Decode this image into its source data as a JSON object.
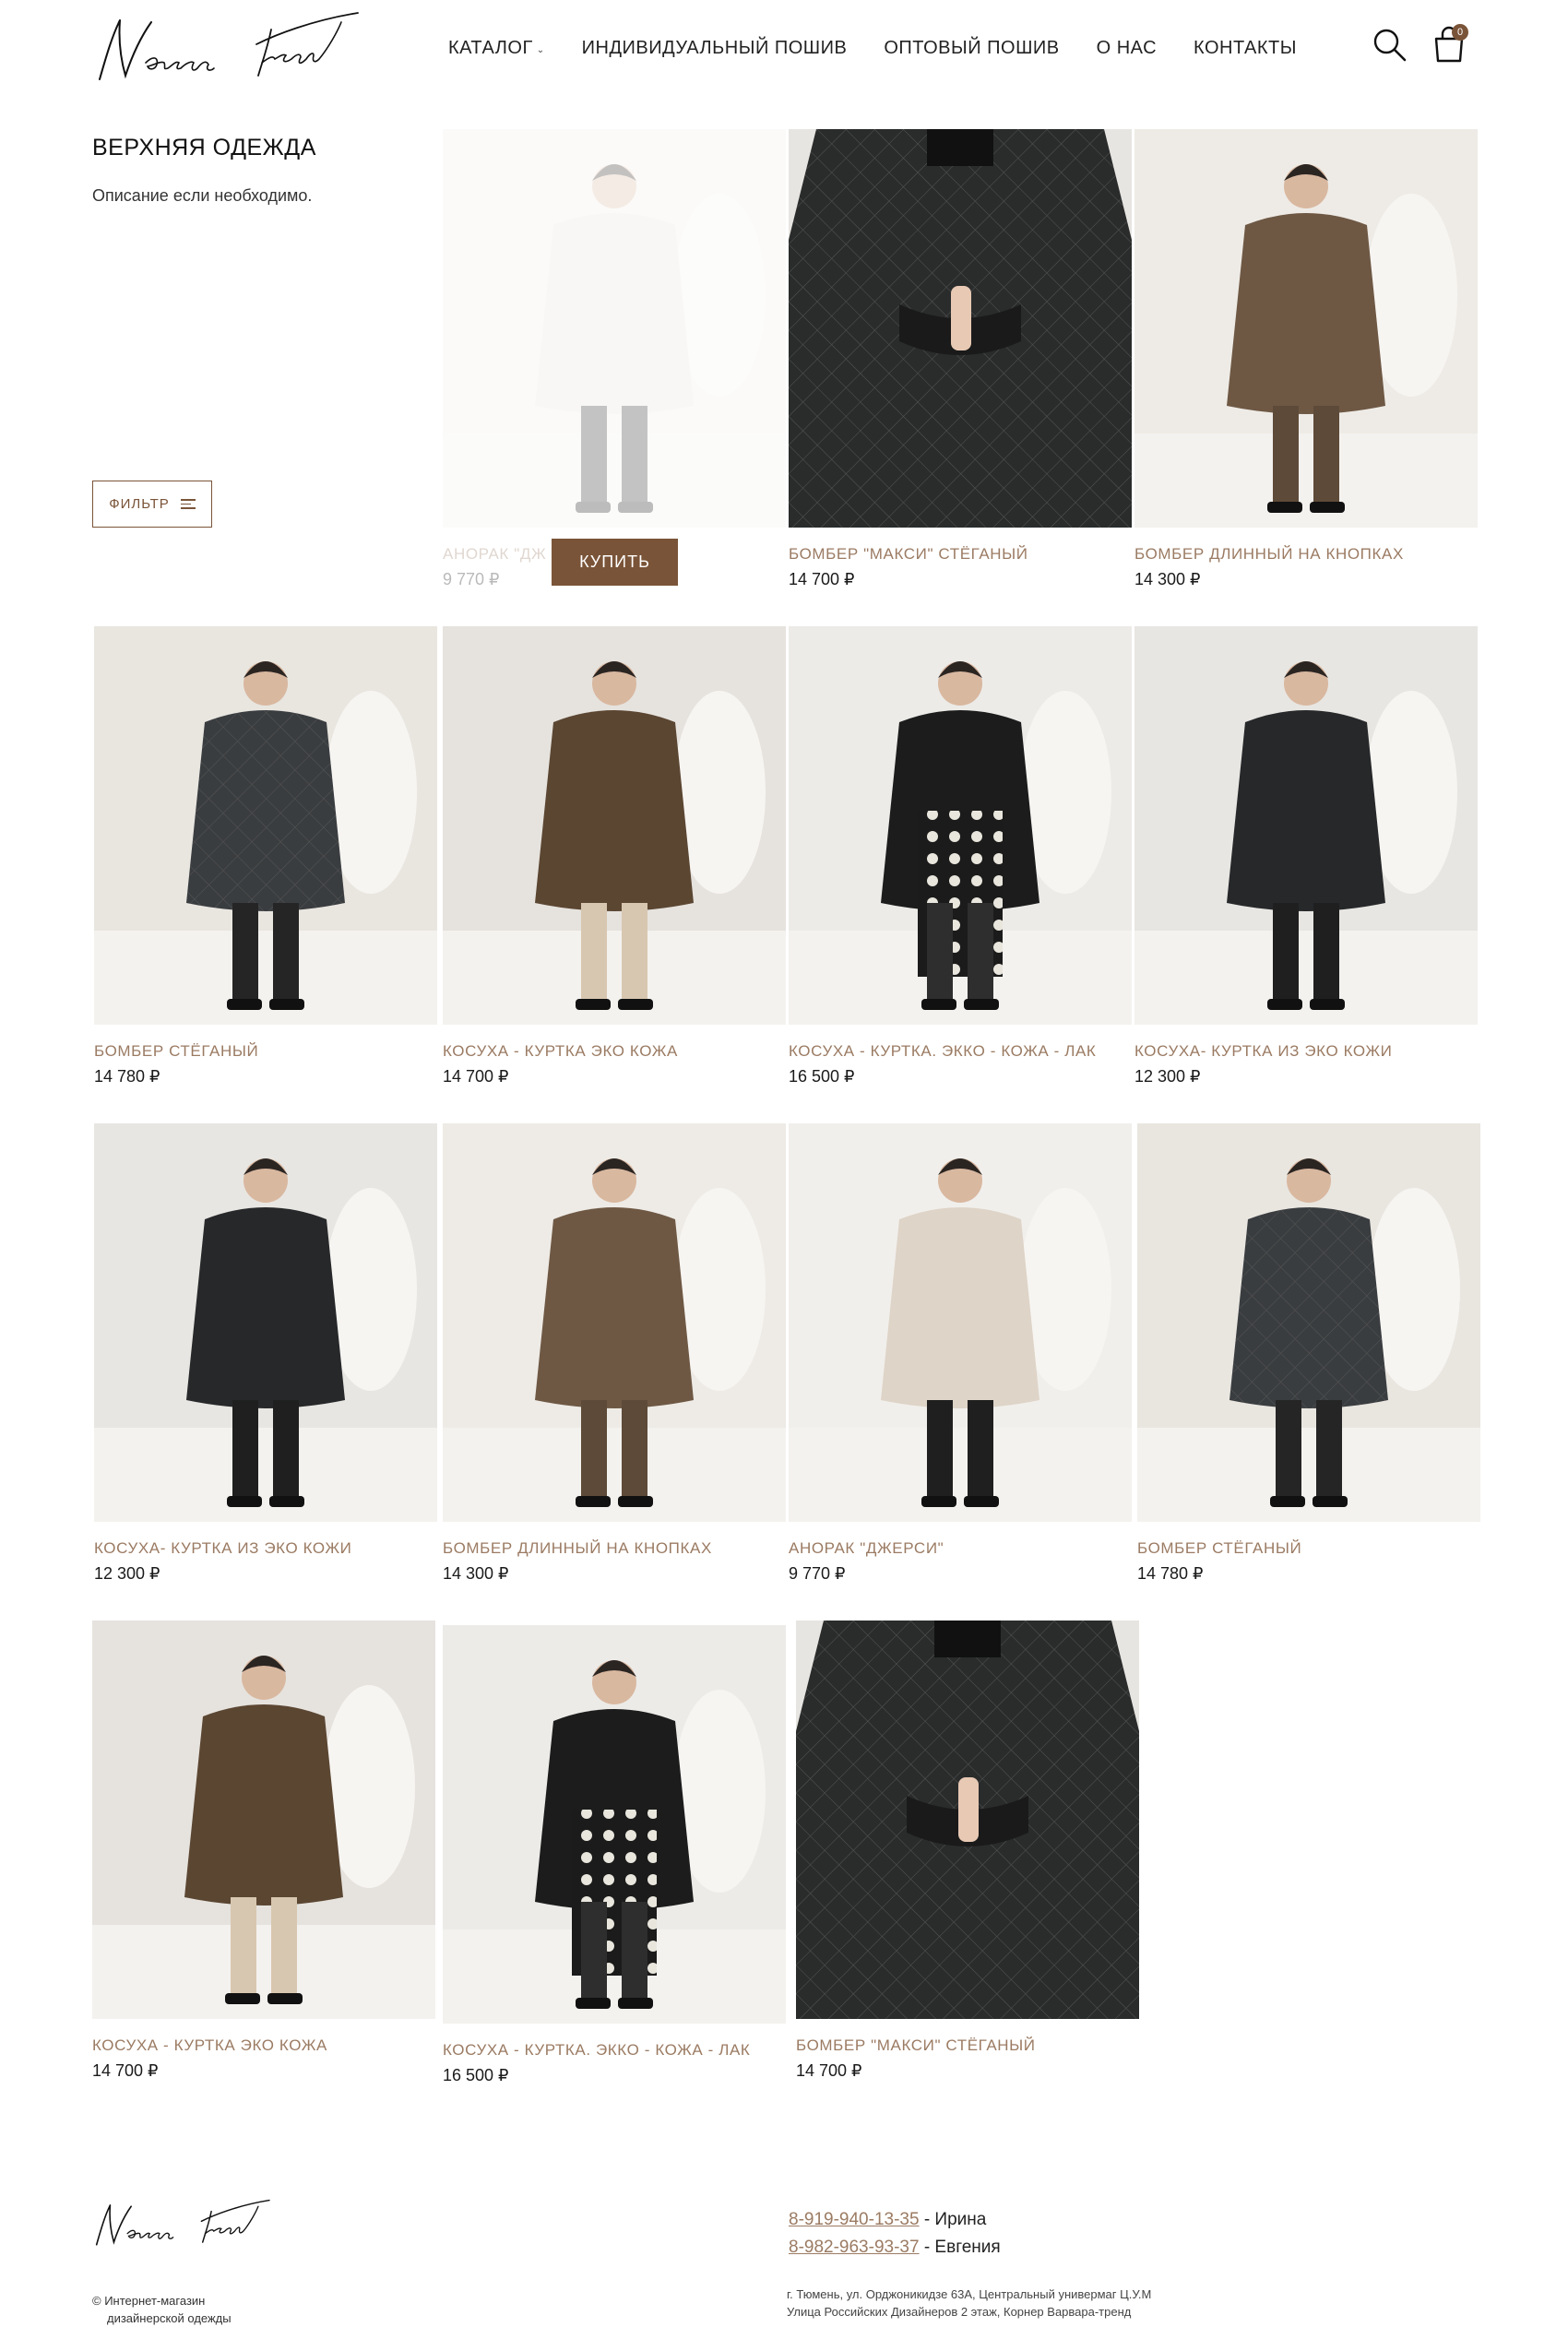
{
  "brand": {
    "logo_text": "Varvara trend"
  },
  "nav": {
    "items": [
      {
        "label": "КАТАЛОГ"
      },
      {
        "label": "ИНДИВИДУАЛЬНЫЙ ПОШИВ"
      },
      {
        "label": "ОПТОВЫЙ ПОШИВ"
      },
      {
        "label": "О НАС"
      },
      {
        "label": "КОНТАКТЫ"
      }
    ],
    "cart_count": "0",
    "icons": [
      "search-icon",
      "cart-icon"
    ]
  },
  "category": {
    "title": "ВЕРХНЯЯ ОДЕЖДА",
    "description": "Описание если необходимо.",
    "filter_label": "ФИЛЬТР"
  },
  "buy_label": "КУПИТЬ",
  "products": [
    {
      "name": "АНОРАК \"ДЖ",
      "price": "9 770 ₽",
      "hovered": true
    },
    {
      "name": "БОМБЕР \"МАКСИ\" СТЁГАНЫЙ",
      "price": "14 700 ₽"
    },
    {
      "name": "БОМБЕР ДЛИННЫЙ НА КНОПКАХ",
      "price": "14 300 ₽"
    },
    {
      "name": "БОМБЕР СТЁГАНЫЙ",
      "price": "14 780 ₽"
    },
    {
      "name": "КОСУХА - КУРТКА ЭКО КОЖА",
      "price": "14 700 ₽"
    },
    {
      "name": "КОСУХА - КУРТКА. ЭККО - КОЖА - ЛАК",
      "price": "16 500 ₽"
    },
    {
      "name": "КОСУХА- КУРТКА ИЗ ЭКО КОЖИ",
      "price": "12 300 ₽"
    },
    {
      "name": "КОСУХА- КУРТКА ИЗ ЭКО КОЖИ",
      "price": "12 300 ₽"
    },
    {
      "name": "БОМБЕР ДЛИННЫЙ НА КНОПКАХ",
      "price": "14 300 ₽"
    },
    {
      "name": "АНОРАК \"ДЖЕРСИ\"",
      "price": "9 770 ₽"
    },
    {
      "name": "БОМБЕР СТЁГАНЫЙ",
      "price": "14 780 ₽"
    },
    {
      "name": "КОСУХА - КУРТКА ЭКО КОЖА",
      "price": "14 700 ₽"
    },
    {
      "name": "КОСУХА - КУРТКА. ЭККО - КОЖА - ЛАК",
      "price": "16 500 ₽"
    },
    {
      "name": "БОМБЕР \"МАКСИ\" СТЁГАНЫЙ",
      "price": "14 700 ₽"
    }
  ],
  "footer": {
    "logo_text": "Varvara trend",
    "copyright_line1": "© Интернет-магазин",
    "copyright_line2": "дизайнерской одежды",
    "phone1": "8-919-940-13-35",
    "phone1_name": " - Ирина",
    "phone2": "8-982-963-93-37",
    "phone2_name": " - Евгения",
    "address_line1": "г. Тюмень, ул. Орджоникидзе 63А, Центральный универмаг Ц.У.М",
    "address_line2": "Улица Российских Дизайнеров 2 этаж, Корнер Варвара-тренд"
  },
  "colors": {
    "accent": "#7a5438",
    "product_name": "#9b7b63"
  }
}
